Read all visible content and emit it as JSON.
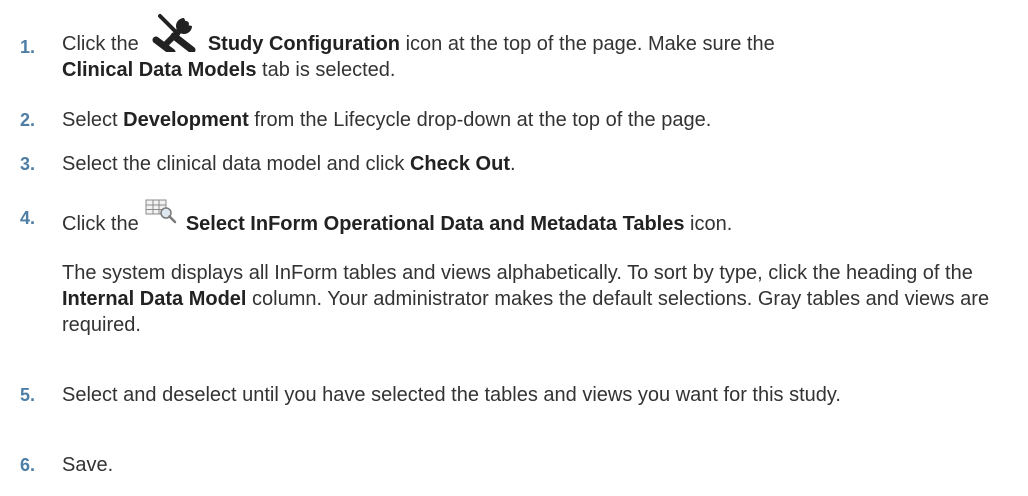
{
  "steps": [
    {
      "number": "1.",
      "lead": "Click the",
      "icon": "wrench-screwdriver-icon",
      "bold1": "Study Configuration",
      "mid1": " icon at the top of the page. Make sure the",
      "bold2": "Clinical Data Models",
      "tail": " tab is selected."
    },
    {
      "number": "2.",
      "lead": "Select ",
      "bold1": "Development",
      "tail": " from the Lifecycle drop-down at the top of the page."
    },
    {
      "number": "3.",
      "lead": "Select the clinical data model and click ",
      "bold1": "Check Out",
      "tail": "."
    },
    {
      "number": "4.",
      "lead": "Click the",
      "icon": "table-search-icon",
      "bold1": "Select InForm Operational Data and Metadata Tables",
      "tail": " icon."
    },
    {
      "para_lead": "The system displays all InForm tables and views alphabetically. To sort by type, click the heading of the ",
      "para_bold": "Internal Data Model",
      "para_tail": " column. Your administrator makes the default selections. Gray tables and views are required."
    },
    {
      "number": "5.",
      "text": "Select and deselect until you have selected the tables and views you want for this study."
    },
    {
      "number": "6.",
      "text": "Save."
    }
  ]
}
